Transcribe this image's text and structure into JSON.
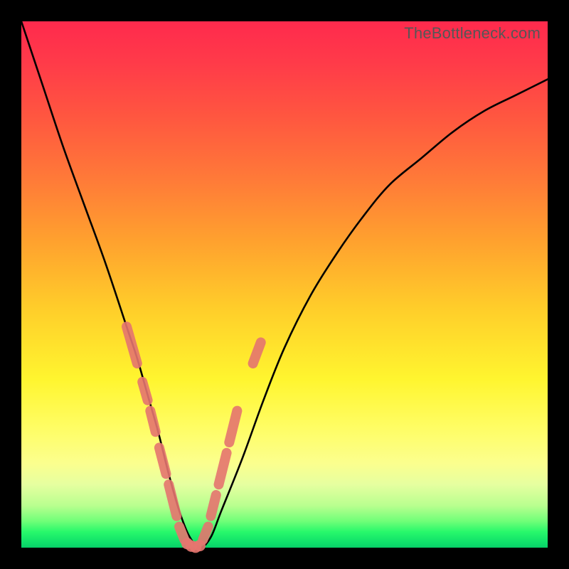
{
  "watermark": "TheBottleneck.com",
  "chart_data": {
    "type": "line",
    "title": "",
    "xlabel": "",
    "ylabel": "",
    "xlim": [
      0,
      100
    ],
    "ylim": [
      0,
      100
    ],
    "grid": false,
    "series": [
      {
        "name": "bottleneck-curve",
        "x": [
          0,
          4,
          8,
          12,
          16,
          20,
          22,
          24,
          26,
          28,
          30,
          32,
          34,
          36,
          38,
          42,
          46,
          50,
          55,
          60,
          65,
          70,
          76,
          82,
          88,
          94,
          100
        ],
        "y": [
          100,
          88,
          76,
          65,
          54,
          42,
          36,
          29,
          22,
          14,
          7,
          2,
          0,
          2,
          7,
          17,
          28,
          38,
          48,
          56,
          63,
          69,
          74,
          79,
          83,
          86,
          89
        ]
      }
    ],
    "markers": [
      {
        "name": "left-pink-segments",
        "color": "#e5756f",
        "segments": [
          {
            "x0": 20.0,
            "y0": 42.0,
            "x1": 22.0,
            "y1": 35.0
          },
          {
            "x0": 23.0,
            "y0": 31.5,
            "x1": 24.0,
            "y1": 28.0
          },
          {
            "x0": 24.5,
            "y0": 26.0,
            "x1": 25.5,
            "y1": 22.0
          },
          {
            "x0": 26.2,
            "y0": 19.0,
            "x1": 27.5,
            "y1": 14.0
          },
          {
            "x0": 28.0,
            "y0": 12.0,
            "x1": 29.5,
            "y1": 6.0
          },
          {
            "x0": 30.0,
            "y0": 4.0,
            "x1": 31.0,
            "y1": 1.5
          }
        ]
      },
      {
        "name": "right-pink-segments",
        "color": "#e5756f",
        "segments": [
          {
            "x0": 34.5,
            "y0": 1.5,
            "x1": 35.5,
            "y1": 4.0
          },
          {
            "x0": 36.0,
            "y0": 6.0,
            "x1": 37.0,
            "y1": 10.0
          },
          {
            "x0": 37.5,
            "y0": 12.0,
            "x1": 39.0,
            "y1": 18.0
          },
          {
            "x0": 39.5,
            "y0": 20.0,
            "x1": 41.0,
            "y1": 26.0
          },
          {
            "x0": 44.0,
            "y0": 35.0,
            "x1": 45.5,
            "y1": 39.0
          }
        ]
      },
      {
        "name": "bottom-pink-dots",
        "color": "#e5756f",
        "points": [
          {
            "x": 31.5,
            "y": 0.8
          },
          {
            "x": 32.3,
            "y": 0.3
          },
          {
            "x": 33.1,
            "y": 0.1
          },
          {
            "x": 33.9,
            "y": 0.4
          }
        ],
        "r": 1.1
      }
    ]
  }
}
